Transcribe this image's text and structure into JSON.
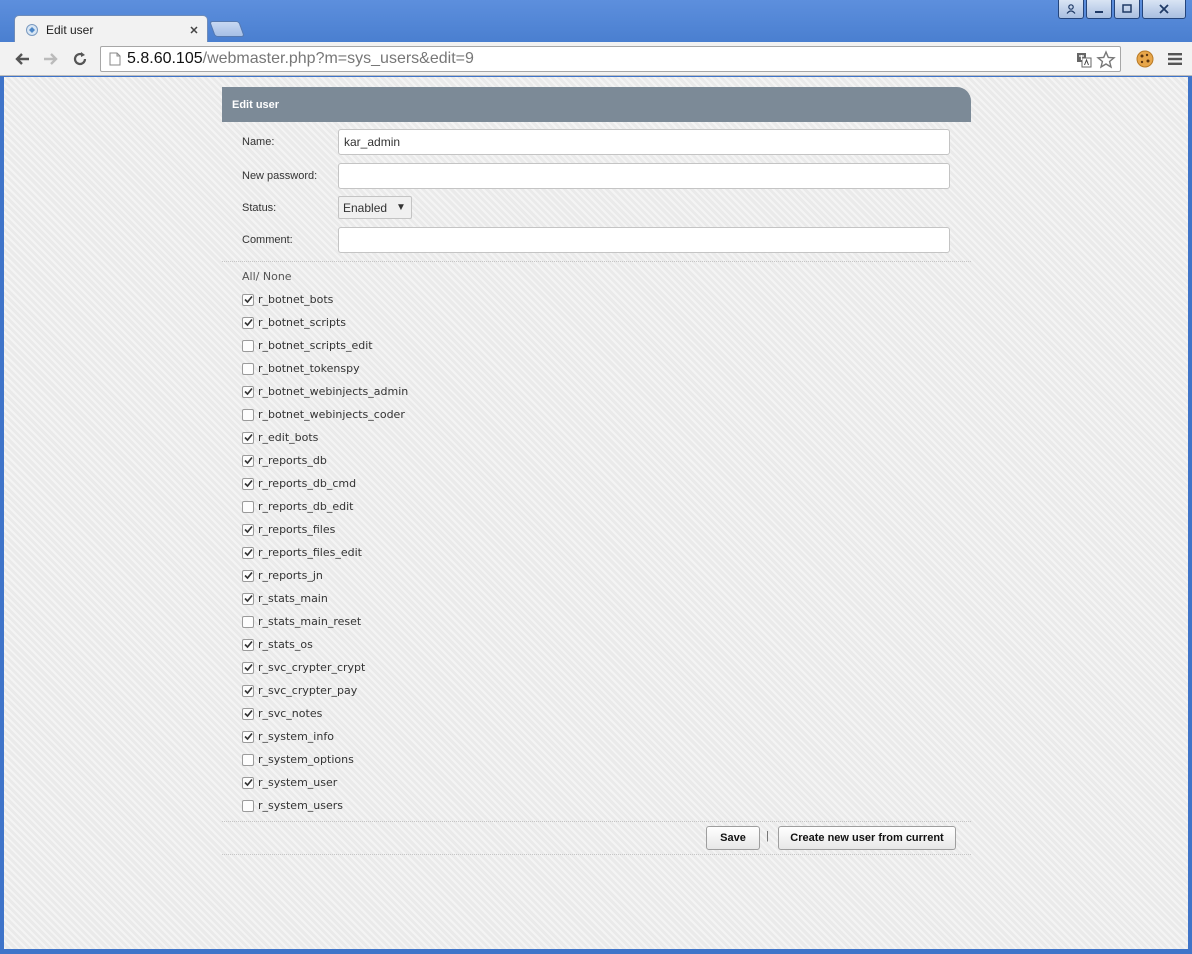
{
  "browser": {
    "tab_title": "Edit user",
    "url_host": "5.8.60.105",
    "url_path": "/webmaster.php?m=sys_users&edit=9"
  },
  "panel": {
    "title": "Edit user"
  },
  "form": {
    "name_label": "Name:",
    "name_value": "kar_admin",
    "password_label": "New password:",
    "password_value": "",
    "status_label": "Status:",
    "status_value": "Enabled",
    "comment_label": "Comment:",
    "comment_value": ""
  },
  "select_links": {
    "all": "All",
    "separator": "/",
    "none": "None"
  },
  "permissions": [
    {
      "name": "r_botnet_bots",
      "checked": true
    },
    {
      "name": "r_botnet_scripts",
      "checked": true
    },
    {
      "name": "r_botnet_scripts_edit",
      "checked": false
    },
    {
      "name": "r_botnet_tokenspy",
      "checked": false
    },
    {
      "name": "r_botnet_webinjects_admin",
      "checked": true
    },
    {
      "name": "r_botnet_webinjects_coder",
      "checked": false
    },
    {
      "name": "r_edit_bots",
      "checked": true
    },
    {
      "name": "r_reports_db",
      "checked": true
    },
    {
      "name": "r_reports_db_cmd",
      "checked": true
    },
    {
      "name": "r_reports_db_edit",
      "checked": false
    },
    {
      "name": "r_reports_files",
      "checked": true
    },
    {
      "name": "r_reports_files_edit",
      "checked": true
    },
    {
      "name": "r_reports_jn",
      "checked": true
    },
    {
      "name": "r_stats_main",
      "checked": true
    },
    {
      "name": "r_stats_main_reset",
      "checked": false
    },
    {
      "name": "r_stats_os",
      "checked": true
    },
    {
      "name": "r_svc_crypter_crypt",
      "checked": true
    },
    {
      "name": "r_svc_crypter_pay",
      "checked": true
    },
    {
      "name": "r_svc_notes",
      "checked": true
    },
    {
      "name": "r_system_info",
      "checked": true
    },
    {
      "name": "r_system_options",
      "checked": false
    },
    {
      "name": "r_system_user",
      "checked": true
    },
    {
      "name": "r_system_users",
      "checked": false
    }
  ],
  "actions": {
    "save_label": "Save",
    "separator": "|",
    "create_label": "Create new user from current"
  },
  "colors": {
    "panel_header": "#7c8a97",
    "window_frame": "#3f74c9"
  }
}
